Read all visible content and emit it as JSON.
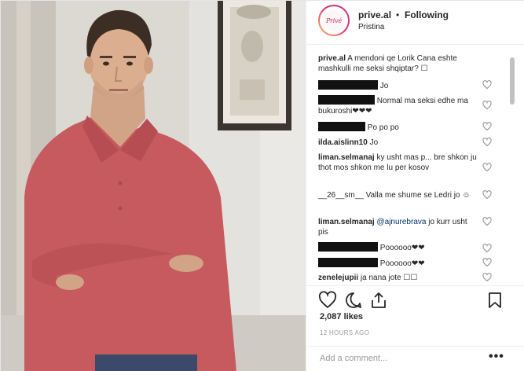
{
  "header": {
    "avatar_logo": "Privé",
    "username": "prive.al",
    "separator": "•",
    "follow_label": "Following",
    "location": "Pristina"
  },
  "comments": [
    {
      "user": "prive.al",
      "text": "A mendoni qe Lorik Cana eshte mashkulli me seksi shqiptar? ☐",
      "redacted": false
    },
    {
      "user": "",
      "text": "Jo",
      "redacted": true
    },
    {
      "user": "",
      "text": "Normal ma seksi edhe ma bukuroshi❤❤❤",
      "redacted": true
    },
    {
      "user": "",
      "text": "Po po po",
      "redacted": true
    },
    {
      "user": "ilda.aislinn10",
      "text": "Jo",
      "redacted": false
    },
    {
      "user": "liman.selmanaj",
      "text": "ky usht mas p... bre shkon ju thot mos shkon me lu per kosov",
      "redacted": false
    },
    {
      "user": "__26__sm__",
      "text": "Valla me shume se Ledri jo ☺",
      "redacted": false
    },
    {
      "user": "liman.selmanaj",
      "mention": "@ajnurebrava",
      "text": "jo kurr usht pis",
      "redacted": false
    },
    {
      "user": "",
      "text": "Poooooo❤❤",
      "redacted": true
    },
    {
      "user": "",
      "text": "Poooooo❤❤",
      "redacted": true
    },
    {
      "user": "zenelejupii",
      "text": "ja nana jote ☐☐",
      "redacted": false
    }
  ],
  "actions": {
    "like_icon": "heart-outline-icon",
    "comment_icon": "comment-bubble-icon",
    "share_icon": "share-upload-icon",
    "save_icon": "bookmark-icon",
    "likes": "2,087 likes",
    "time_ago": "12 HOURS AGO"
  },
  "add_comment": {
    "placeholder": "Add a comment...",
    "more_label": "•••"
  },
  "colors": {
    "shirt": "#c65a5e",
    "background": "#d9d7d1",
    "redaction": "#111111",
    "mention": "#003569"
  }
}
